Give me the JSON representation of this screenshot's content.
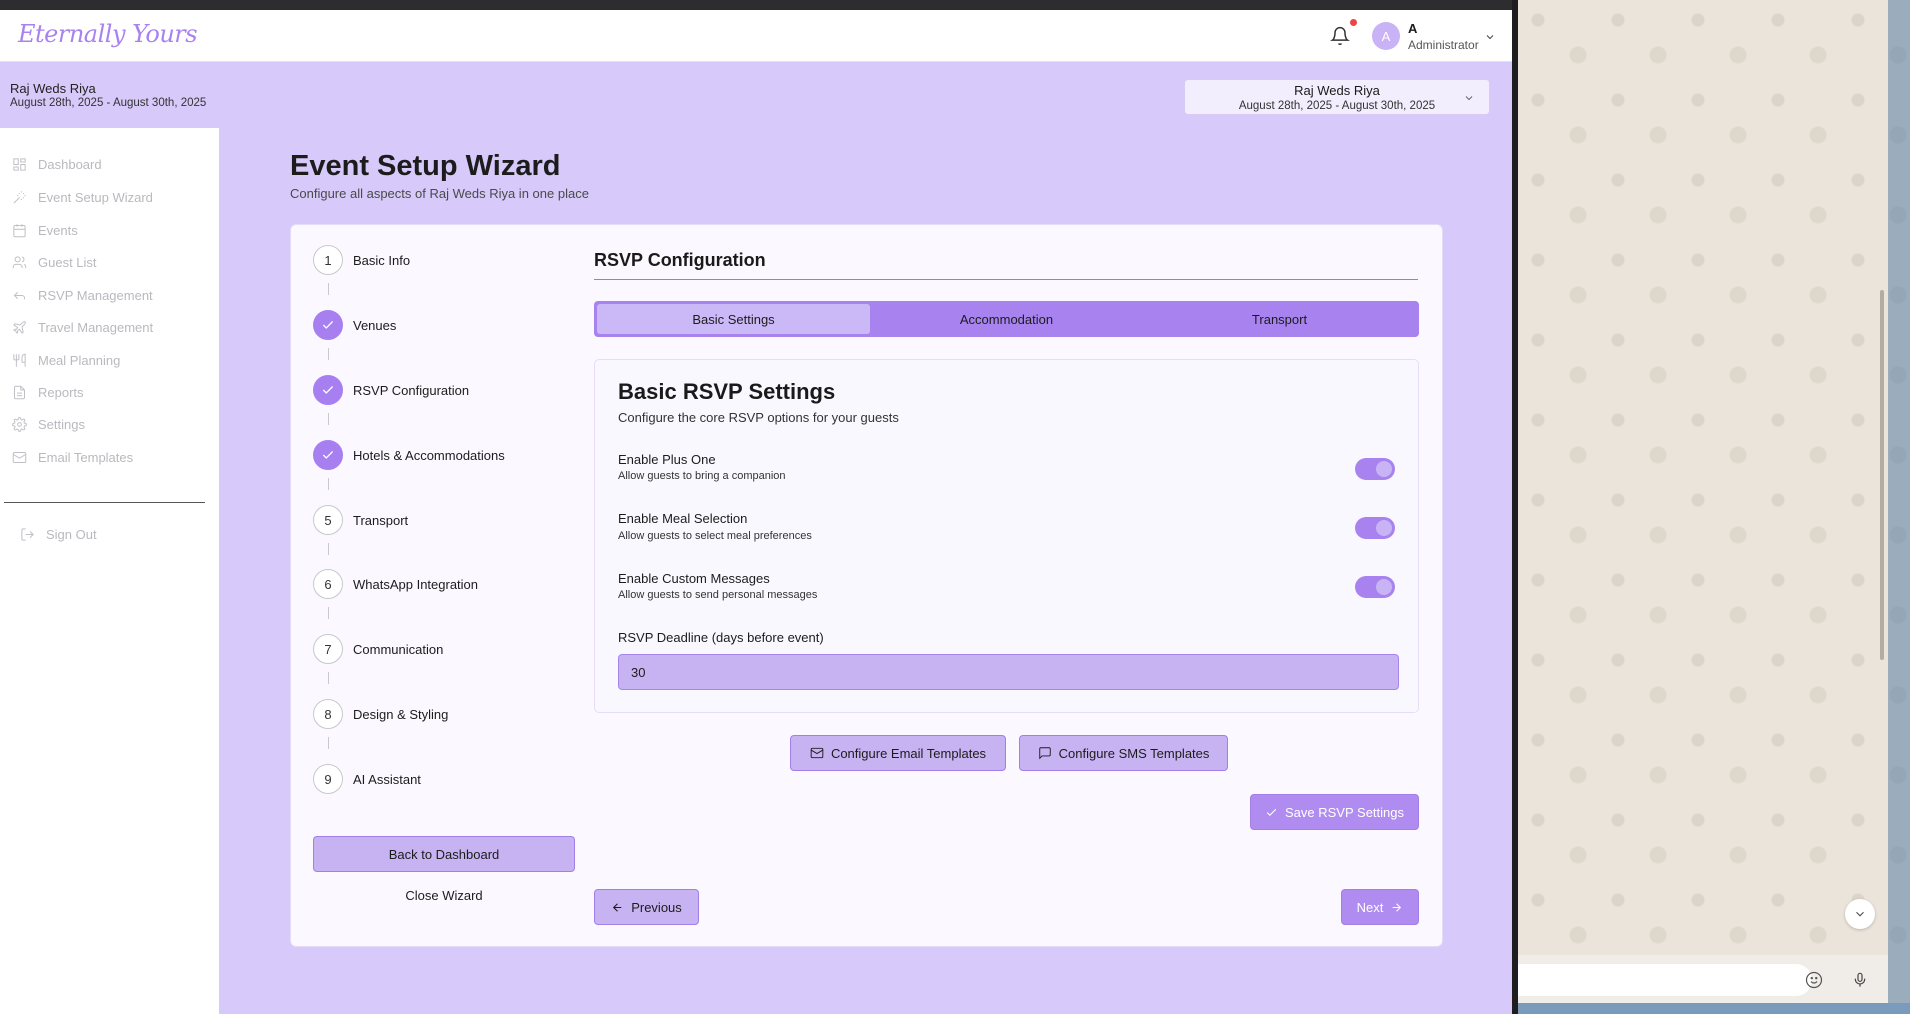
{
  "app": {
    "logo": "Eternally Yours",
    "user": {
      "initial": "A",
      "name": "A",
      "role": "Administrator"
    }
  },
  "wedding": {
    "title": "Raj Weds Riya",
    "dates": "August 28th, 2025 - August 30th, 2025"
  },
  "event_selector": {
    "title": "Raj Weds Riya",
    "dates": "August 28th, 2025 - August 30th, 2025"
  },
  "sidebar": {
    "items": [
      {
        "label": "Dashboard",
        "icon": "dashboard-icon"
      },
      {
        "label": "Event Setup Wizard",
        "icon": "wand-icon"
      },
      {
        "label": "Events",
        "icon": "calendar-icon"
      },
      {
        "label": "Guest List",
        "icon": "users-icon"
      },
      {
        "label": "RSVP Management",
        "icon": "reply-icon"
      },
      {
        "label": "Travel Management",
        "icon": "plane-icon"
      },
      {
        "label": "Meal Planning",
        "icon": "utensils-icon"
      },
      {
        "label": "Reports",
        "icon": "file-icon"
      },
      {
        "label": "Settings",
        "icon": "gear-icon"
      },
      {
        "label": "Email Templates",
        "icon": "mail-icon"
      }
    ],
    "sign_out": "Sign Out"
  },
  "page": {
    "title": "Event Setup Wizard",
    "subtitle": "Configure all aspects of Raj Weds Riya in one place"
  },
  "wizard": {
    "steps": [
      {
        "number": "1",
        "label": "Basic Info",
        "completed": false
      },
      {
        "number": "2",
        "label": "Venues",
        "completed": true
      },
      {
        "number": "3",
        "label": "RSVP Configuration",
        "completed": true
      },
      {
        "number": "4",
        "label": "Hotels & Accommodations",
        "completed": true
      },
      {
        "number": "5",
        "label": "Transport",
        "completed": false
      },
      {
        "number": "6",
        "label": "WhatsApp Integration",
        "completed": false
      },
      {
        "number": "7",
        "label": "Communication",
        "completed": false
      },
      {
        "number": "8",
        "label": "Design & Styling",
        "completed": false
      },
      {
        "number": "9",
        "label": "AI Assistant",
        "completed": false
      }
    ],
    "back_label": "Back to Dashboard",
    "close_label": "Close Wizard"
  },
  "rsvp": {
    "section_title": "RSVP Configuration",
    "tabs": [
      {
        "label": "Basic Settings",
        "active": true
      },
      {
        "label": "Accommodation",
        "active": false
      },
      {
        "label": "Transport",
        "active": false
      }
    ],
    "settings_title": "Basic RSVP Settings",
    "settings_subtitle": "Configure the core RSVP options for your guests",
    "options": [
      {
        "title": "Enable Plus One",
        "description": "Allow guests to bring a companion",
        "enabled": true
      },
      {
        "title": "Enable Meal Selection",
        "description": "Allow guests to select meal preferences",
        "enabled": true
      },
      {
        "title": "Enable Custom Messages",
        "description": "Allow guests to send personal messages",
        "enabled": true
      }
    ],
    "deadline_label": "RSVP Deadline (days before event)",
    "deadline_value": "30",
    "email_templates_label": "Configure Email Templates",
    "sms_templates_label": "Configure SMS Templates",
    "save_label": "Save RSVP Settings",
    "previous_label": "Previous",
    "next_label": "Next"
  },
  "colors": {
    "accent": "#a883ef",
    "background": "#d7c9f9",
    "card": "#fbf9ff"
  }
}
